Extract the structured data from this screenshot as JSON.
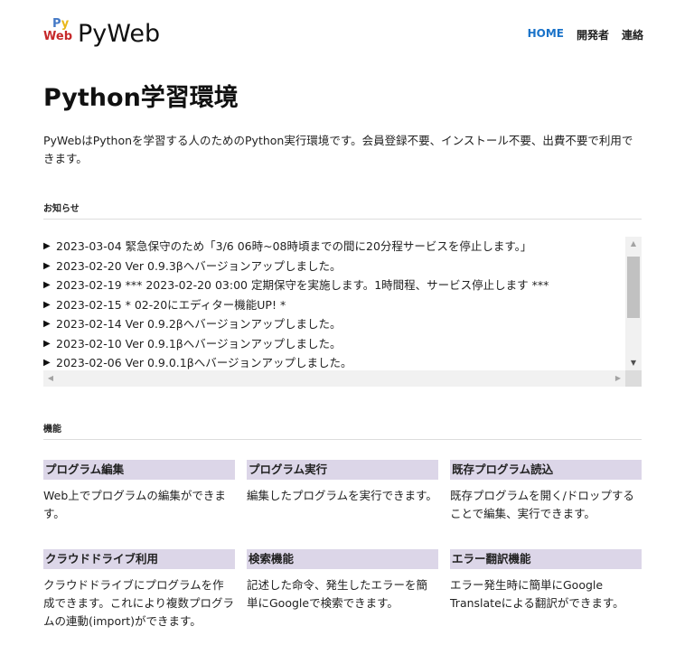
{
  "header": {
    "logo_py": "Py",
    "logo_web": "Web",
    "logo_text": "PyWeb",
    "nav": [
      {
        "label": "HOME",
        "active": true
      },
      {
        "label": "開発者",
        "active": false
      },
      {
        "label": "連絡",
        "active": false
      }
    ]
  },
  "main": {
    "title": "Python学習環境",
    "intro": "PyWebはPythonを学習する人のためのPython実行環境です。会員登録不要、インストール不要、出費不要で利用できます。"
  },
  "news": {
    "label": "お知らせ",
    "items": [
      "2023-03-04 緊急保守のため「3/6 06時~08時頃までの間に20分程サービスを停止します。」",
      "2023-02-20 Ver 0.9.3βへバージョンアップしました。",
      "2023-02-19 *** 2023-02-20 03:00 定期保守を実施します。1時間程、サービス停止します ***",
      "2023-02-15 * 02-20にエディター機能UP! *",
      "2023-02-14 Ver 0.9.2βへバージョンアップしました。",
      "2023-02-10 Ver 0.9.1βへバージョンアップしました。",
      "2023-02-06 Ver 0.9.0.1βへバージョンアップしました。"
    ]
  },
  "features": {
    "label": "機能",
    "items": [
      {
        "title": "プログラム編集",
        "desc": "Web上でプログラムの編集ができます。"
      },
      {
        "title": "プログラム実行",
        "desc": "編集したプログラムを実行できます。"
      },
      {
        "title": "既存プログラム読込",
        "desc": "既存プログラムを開く/ドロップすることで編集、実行できます。"
      },
      {
        "title": "クラウドドライブ利用",
        "desc": "クラウドドライブにプログラムを作成できます。これにより複数プログラムの連動(import)ができます。"
      },
      {
        "title": "検索機能",
        "desc": "記述した命令、発生したエラーを簡単にGoogleで検索できます。"
      },
      {
        "title": "エラー翻訳機能",
        "desc": "エラー発生時に簡単にGoogle Translateによる翻訳ができます。"
      }
    ]
  },
  "colors": {
    "accent": "#1a73c9",
    "feature_header_bg": "#dcd6e8",
    "logo_red": "#c6282a",
    "logo_blue": "#4479c6",
    "logo_yellow": "#e9b81a"
  }
}
